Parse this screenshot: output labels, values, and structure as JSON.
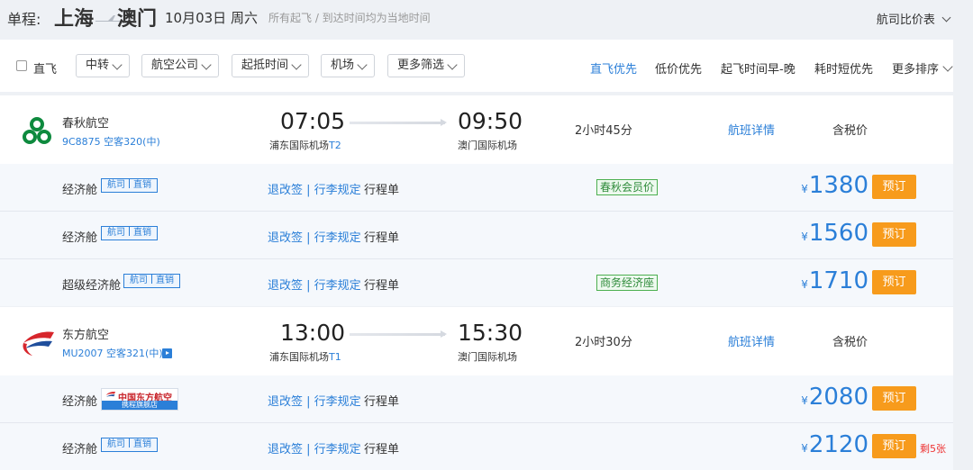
{
  "header": {
    "prefix": "单程:",
    "from_city": "上海",
    "to_city": "澳门",
    "date": "10月03日 周六",
    "note": "所有起飞 / 到达时间均为当地时间",
    "compare_label": "航司比价表"
  },
  "filters": {
    "direct_label": "直飞",
    "dropdowns": [
      "中转",
      "航空公司",
      "起抵时间",
      "机场",
      "更多筛选"
    ]
  },
  "sorts": [
    "直飞优先",
    "低价优先",
    "起飞时间早-晚",
    "耗时短优先",
    "更多排序"
  ],
  "flights": [
    {
      "airline": "春秋航空",
      "flight_info": "9C8875 空客320(中)",
      "dep_time": "07:05",
      "dep_airport": "浦东国际机场",
      "dep_terminal": "T2",
      "arr_time": "09:50",
      "arr_airport": "澳门国际机场",
      "duration": "2小时45分",
      "detail_label": "航班详情",
      "tax_label": "含税价",
      "colors": {
        "logo": "#0e8a3e"
      },
      "fares": [
        {
          "cabin": "经济舱",
          "tag": [
            "航司",
            "直销"
          ],
          "rules": "退改签 | 行李规定",
          "itinerary": "行程单",
          "promo": "春秋会员价",
          "currency": "¥",
          "price": "1380",
          "book": "预订"
        },
        {
          "cabin": "经济舱",
          "tag": [
            "航司",
            "直销"
          ],
          "rules": "退改签 | 行李规定",
          "itinerary": "行程单",
          "promo": "",
          "currency": "¥",
          "price": "1560",
          "book": "预订"
        },
        {
          "cabin": "超级经济舱",
          "tag": [
            "航司",
            "直销"
          ],
          "rules": "退改签 | 行李规定",
          "itinerary": "行程单",
          "promo": "商务经济座",
          "currency": "¥",
          "price": "1710",
          "book": "预订"
        }
      ]
    },
    {
      "airline": "东方航空",
      "flight_info": "MU2007 空客321(中)",
      "dep_time": "13:00",
      "dep_airport": "浦东国际机场",
      "dep_terminal": "T1",
      "arr_time": "15:30",
      "arr_airport": "澳门国际机场",
      "duration": "2小时30分",
      "detail_label": "航班详情",
      "tax_label": "含税价",
      "colors": {
        "logo_red": "#d7262c",
        "logo_blue": "#1f4e9c"
      },
      "fares": [
        {
          "cabin": "经济舱",
          "badge_main": "中国东方航空",
          "badge_sub": "携程旗舰店",
          "rules": "退改签 | 行李规定",
          "itinerary": "行程单",
          "currency": "¥",
          "price": "2080",
          "book": "预订"
        },
        {
          "cabin": "经济舱",
          "tag": [
            "航司",
            "直销"
          ],
          "rules": "退改签 | 行李规定",
          "itinerary": "行程单",
          "currency": "¥",
          "price": "2120",
          "book": "预订",
          "remaining": "剩5张"
        }
      ]
    }
  ],
  "colors": {
    "accent": "#2b7fd8",
    "book_button": "#f79b1c",
    "promo_green": "#2e8b3a",
    "alert_red": "#e33333"
  }
}
